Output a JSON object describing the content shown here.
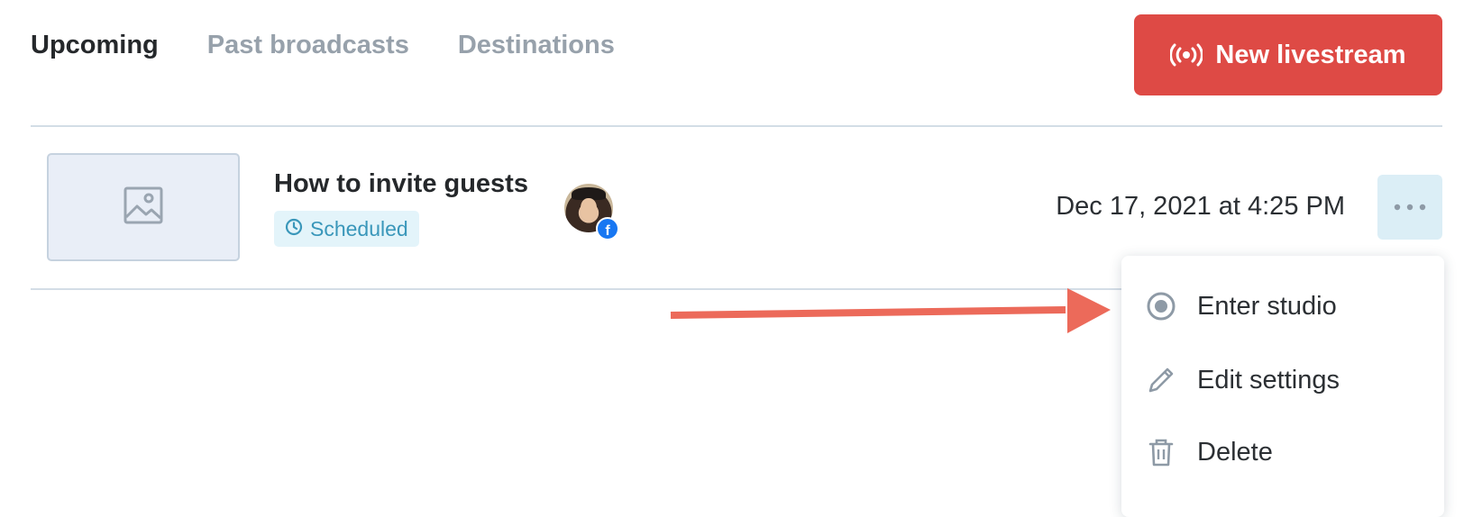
{
  "tabs": [
    {
      "label": "Upcoming",
      "active": true
    },
    {
      "label": "Past broadcasts",
      "active": false
    },
    {
      "label": "Destinations",
      "active": false
    }
  ],
  "new_button": {
    "label": "New livestream",
    "icon": "broadcast-icon"
  },
  "broadcast": {
    "title": "How to invite guests",
    "status": "Scheduled",
    "status_icon": "clock-icon",
    "destination_icon": "facebook-icon",
    "date": "Dec 17, 2021 at 4:25 PM"
  },
  "menu": {
    "items": [
      {
        "label": "Enter studio",
        "icon": "record-icon"
      },
      {
        "label": "Edit settings",
        "icon": "pencil-icon"
      },
      {
        "label": "Delete",
        "icon": "trash-icon"
      }
    ]
  },
  "colors": {
    "accent": "#de4a45",
    "status_text": "#3a97ba",
    "status_bg": "#e3f4fa",
    "annotation_arrow": "#ec6a5a"
  }
}
